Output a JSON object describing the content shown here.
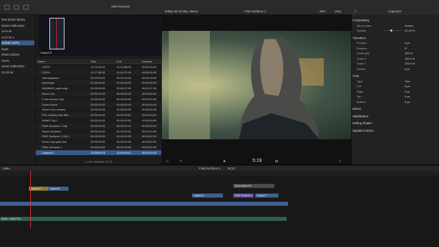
{
  "toolbar": {
    "title": "Hide Rejected"
  },
  "libraries": {
    "items": [
      {
        "label": "New Zicaro library",
        "selected": false
      },
      {
        "label": "Smart Collections",
        "selected": false
      },
      {
        "label": "12-8-16",
        "selected": false
      },
      {
        "label": "12-8-16 1",
        "selected": false
      },
      {
        "label": "GOOD CUTS",
        "selected": true
      },
      {
        "label": "logos",
        "selected": false
      },
      {
        "label": "Zicaro Library",
        "selected": false
      },
      {
        "label": "zicare",
        "selected": false
      },
      {
        "label": "Smart Collections",
        "selected": false
      },
      {
        "label": "10-26-16",
        "selected": false
      }
    ]
  },
  "browser": {
    "thumb_label": "Legacy13",
    "columns": [
      "Name",
      "Start",
      "End",
      "Duration"
    ],
    "rows": [
      {
        "name": "C0091",
        "start": "11:14:13:03",
        "end": "11:14:58:03",
        "dur": "00:00:44:00"
      },
      {
        "name": "C0094",
        "start": "11:17:38:08",
        "end": "11:18:17:08",
        "dur": "00:00:39:00"
      },
      {
        "name": "videoplayback",
        "start": "00:00:00:00",
        "end": "00:04:15:02",
        "dur": "00:04:15:02"
      },
      {
        "name": "zicarologo",
        "start": "01:00:00:00",
        "end": "01:00:00:00",
        "dur": "00:00:05:00"
      },
      {
        "name": "18439803_zynth-wgi...",
        "start": "00:00:00:00",
        "end": "00:02:47:00",
        "dur": "00:02:47:00"
      },
      {
        "name": "Home Clip",
        "start": "00:00:00:00",
        "end": "00:00:05:20",
        "dur": "00:00:05:20"
      },
      {
        "name": "2 min version Clip",
        "start": "00:00:00:00",
        "end": "00:00:00:00",
        "dur": "00:02:00:00"
      },
      {
        "name": "Zicaro Home",
        "start": "00:00:00:00",
        "end": "00:00:00:00",
        "dur": "00:00:00:00"
      },
      {
        "name": "Zicaro Fine Jewelry",
        "start": "00:00:00:00",
        "end": "00:00:00:00",
        "dur": "00:00:00:00"
      },
      {
        "name": "Fine Jewelry new title...",
        "start": "00:00:00:00",
        "end": "00:00:03:21",
        "dur": "00:00:03:21"
      },
      {
        "name": "HOME Clip 1",
        "start": "00:00:00:00",
        "end": "00:00:00:00",
        "dur": "00:00:05:00"
      },
      {
        "name": "FINE Surfaces 1 Clip",
        "start": "00:00:00:00",
        "end": "00:00:03:21",
        "dur": "00:00:03:21"
      },
      {
        "name": "Zicaro Surfaces",
        "start": "00:00:00:00",
        "end": "00:00:00:00",
        "dur": "00:00:00:00"
      },
      {
        "name": "FINE Surfaces 1 Clip 1",
        "start": "00:00:00:00",
        "end": "00:00:02:23",
        "dur": "00:00:02:23"
      },
      {
        "name": "Zicaro logo grey font",
        "start": "00:00:00:00",
        "end": "00:00:00:00",
        "dur": "00:00:00:00"
      },
      {
        "name": "FINE Surfaces 1",
        "start": "00:00:00:00",
        "end": "00:00:00:00",
        "dur": "00:00:00:00"
      },
      {
        "name": "Legacy13",
        "start": "12:03:55:19",
        "end": "12:04:09:13",
        "dur": "00:00:13:19"
      }
    ],
    "selected_row": 16,
    "footer": "1 of 61 selected, 01:19"
  },
  "viewer": {
    "format": "1080p HD 23.98p, Stereo",
    "title": "FINE Surfaces 1",
    "zoom": "83%",
    "view_label": "View",
    "timecode": "5:19"
  },
  "inspector": {
    "clip_name": "Legacy13",
    "sections": [
      {
        "title": "Compositing",
        "props": [
          {
            "name": "Blend Mode",
            "value": "Screen"
          },
          {
            "name": "Opacity",
            "value": "42.15 %",
            "slider": 0.42
          }
        ]
      },
      {
        "title": "Transform",
        "props": [
          {
            "name": "Position",
            "value": "0 px"
          },
          {
            "name": "Rotation",
            "value": "0°"
          },
          {
            "name": "Scale (All)",
            "value": "100 %"
          },
          {
            "name": "Scale X",
            "value": "100.0 %"
          },
          {
            "name": "Scale Y",
            "value": "100.0 %"
          },
          {
            "name": "Anchor",
            "value": "0 px"
          }
        ]
      },
      {
        "title": "Crop",
        "props": [
          {
            "name": "Type",
            "value": "Trim"
          },
          {
            "name": "Left",
            "value": "0 px"
          },
          {
            "name": "Right",
            "value": "0 px"
          },
          {
            "name": "Top",
            "value": "0 px"
          },
          {
            "name": "Bottom",
            "value": "0 px"
          }
        ]
      },
      {
        "title": "Distort",
        "props": []
      },
      {
        "title": "Stabilization",
        "props": []
      },
      {
        "title": "Rolling Shutter",
        "props": []
      },
      {
        "title": "Spatial Conform",
        "props": []
      }
    ]
  },
  "timeline": {
    "index_label": "Index",
    "title": "FINE Surfaces 1",
    "duration": "50:22",
    "audio_clip": "Music - Synth Pop",
    "clips": [
      {
        "label": "Legacy13",
        "color": "y"
      },
      {
        "label": "Legacy13",
        "color": "v"
      },
      {
        "label": "Zicaro Black Bri",
        "color": "g"
      },
      {
        "label": "FINE Surfaces 1",
        "color": "p"
      },
      {
        "label": "Legacy13",
        "color": "v"
      },
      {
        "label": "Legacy17",
        "color": "v"
      }
    ]
  },
  "colors": {
    "accent": "#3a5a8a",
    "playhead": "#d03030",
    "audio": "#2f5e55"
  }
}
